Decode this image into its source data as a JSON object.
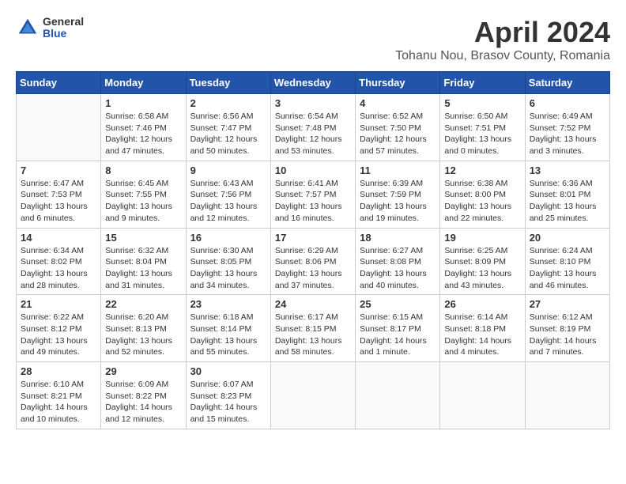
{
  "header": {
    "logo_general": "General",
    "logo_blue": "Blue",
    "month_title": "April 2024",
    "location": "Tohanu Nou, Brasov County, Romania"
  },
  "days_of_week": [
    "Sunday",
    "Monday",
    "Tuesday",
    "Wednesday",
    "Thursday",
    "Friday",
    "Saturday"
  ],
  "weeks": [
    [
      {
        "day": "",
        "info": ""
      },
      {
        "day": "1",
        "info": "Sunrise: 6:58 AM\nSunset: 7:46 PM\nDaylight: 12 hours\nand 47 minutes."
      },
      {
        "day": "2",
        "info": "Sunrise: 6:56 AM\nSunset: 7:47 PM\nDaylight: 12 hours\nand 50 minutes."
      },
      {
        "day": "3",
        "info": "Sunrise: 6:54 AM\nSunset: 7:48 PM\nDaylight: 12 hours\nand 53 minutes."
      },
      {
        "day": "4",
        "info": "Sunrise: 6:52 AM\nSunset: 7:50 PM\nDaylight: 12 hours\nand 57 minutes."
      },
      {
        "day": "5",
        "info": "Sunrise: 6:50 AM\nSunset: 7:51 PM\nDaylight: 13 hours\nand 0 minutes."
      },
      {
        "day": "6",
        "info": "Sunrise: 6:49 AM\nSunset: 7:52 PM\nDaylight: 13 hours\nand 3 minutes."
      }
    ],
    [
      {
        "day": "7",
        "info": "Sunrise: 6:47 AM\nSunset: 7:53 PM\nDaylight: 13 hours\nand 6 minutes."
      },
      {
        "day": "8",
        "info": "Sunrise: 6:45 AM\nSunset: 7:55 PM\nDaylight: 13 hours\nand 9 minutes."
      },
      {
        "day": "9",
        "info": "Sunrise: 6:43 AM\nSunset: 7:56 PM\nDaylight: 13 hours\nand 12 minutes."
      },
      {
        "day": "10",
        "info": "Sunrise: 6:41 AM\nSunset: 7:57 PM\nDaylight: 13 hours\nand 16 minutes."
      },
      {
        "day": "11",
        "info": "Sunrise: 6:39 AM\nSunset: 7:59 PM\nDaylight: 13 hours\nand 19 minutes."
      },
      {
        "day": "12",
        "info": "Sunrise: 6:38 AM\nSunset: 8:00 PM\nDaylight: 13 hours\nand 22 minutes."
      },
      {
        "day": "13",
        "info": "Sunrise: 6:36 AM\nSunset: 8:01 PM\nDaylight: 13 hours\nand 25 minutes."
      }
    ],
    [
      {
        "day": "14",
        "info": "Sunrise: 6:34 AM\nSunset: 8:02 PM\nDaylight: 13 hours\nand 28 minutes."
      },
      {
        "day": "15",
        "info": "Sunrise: 6:32 AM\nSunset: 8:04 PM\nDaylight: 13 hours\nand 31 minutes."
      },
      {
        "day": "16",
        "info": "Sunrise: 6:30 AM\nSunset: 8:05 PM\nDaylight: 13 hours\nand 34 minutes."
      },
      {
        "day": "17",
        "info": "Sunrise: 6:29 AM\nSunset: 8:06 PM\nDaylight: 13 hours\nand 37 minutes."
      },
      {
        "day": "18",
        "info": "Sunrise: 6:27 AM\nSunset: 8:08 PM\nDaylight: 13 hours\nand 40 minutes."
      },
      {
        "day": "19",
        "info": "Sunrise: 6:25 AM\nSunset: 8:09 PM\nDaylight: 13 hours\nand 43 minutes."
      },
      {
        "day": "20",
        "info": "Sunrise: 6:24 AM\nSunset: 8:10 PM\nDaylight: 13 hours\nand 46 minutes."
      }
    ],
    [
      {
        "day": "21",
        "info": "Sunrise: 6:22 AM\nSunset: 8:12 PM\nDaylight: 13 hours\nand 49 minutes."
      },
      {
        "day": "22",
        "info": "Sunrise: 6:20 AM\nSunset: 8:13 PM\nDaylight: 13 hours\nand 52 minutes."
      },
      {
        "day": "23",
        "info": "Sunrise: 6:18 AM\nSunset: 8:14 PM\nDaylight: 13 hours\nand 55 minutes."
      },
      {
        "day": "24",
        "info": "Sunrise: 6:17 AM\nSunset: 8:15 PM\nDaylight: 13 hours\nand 58 minutes."
      },
      {
        "day": "25",
        "info": "Sunrise: 6:15 AM\nSunset: 8:17 PM\nDaylight: 14 hours\nand 1 minute."
      },
      {
        "day": "26",
        "info": "Sunrise: 6:14 AM\nSunset: 8:18 PM\nDaylight: 14 hours\nand 4 minutes."
      },
      {
        "day": "27",
        "info": "Sunrise: 6:12 AM\nSunset: 8:19 PM\nDaylight: 14 hours\nand 7 minutes."
      }
    ],
    [
      {
        "day": "28",
        "info": "Sunrise: 6:10 AM\nSunset: 8:21 PM\nDaylight: 14 hours\nand 10 minutes."
      },
      {
        "day": "29",
        "info": "Sunrise: 6:09 AM\nSunset: 8:22 PM\nDaylight: 14 hours\nand 12 minutes."
      },
      {
        "day": "30",
        "info": "Sunrise: 6:07 AM\nSunset: 8:23 PM\nDaylight: 14 hours\nand 15 minutes."
      },
      {
        "day": "",
        "info": ""
      },
      {
        "day": "",
        "info": ""
      },
      {
        "day": "",
        "info": ""
      },
      {
        "day": "",
        "info": ""
      }
    ]
  ]
}
